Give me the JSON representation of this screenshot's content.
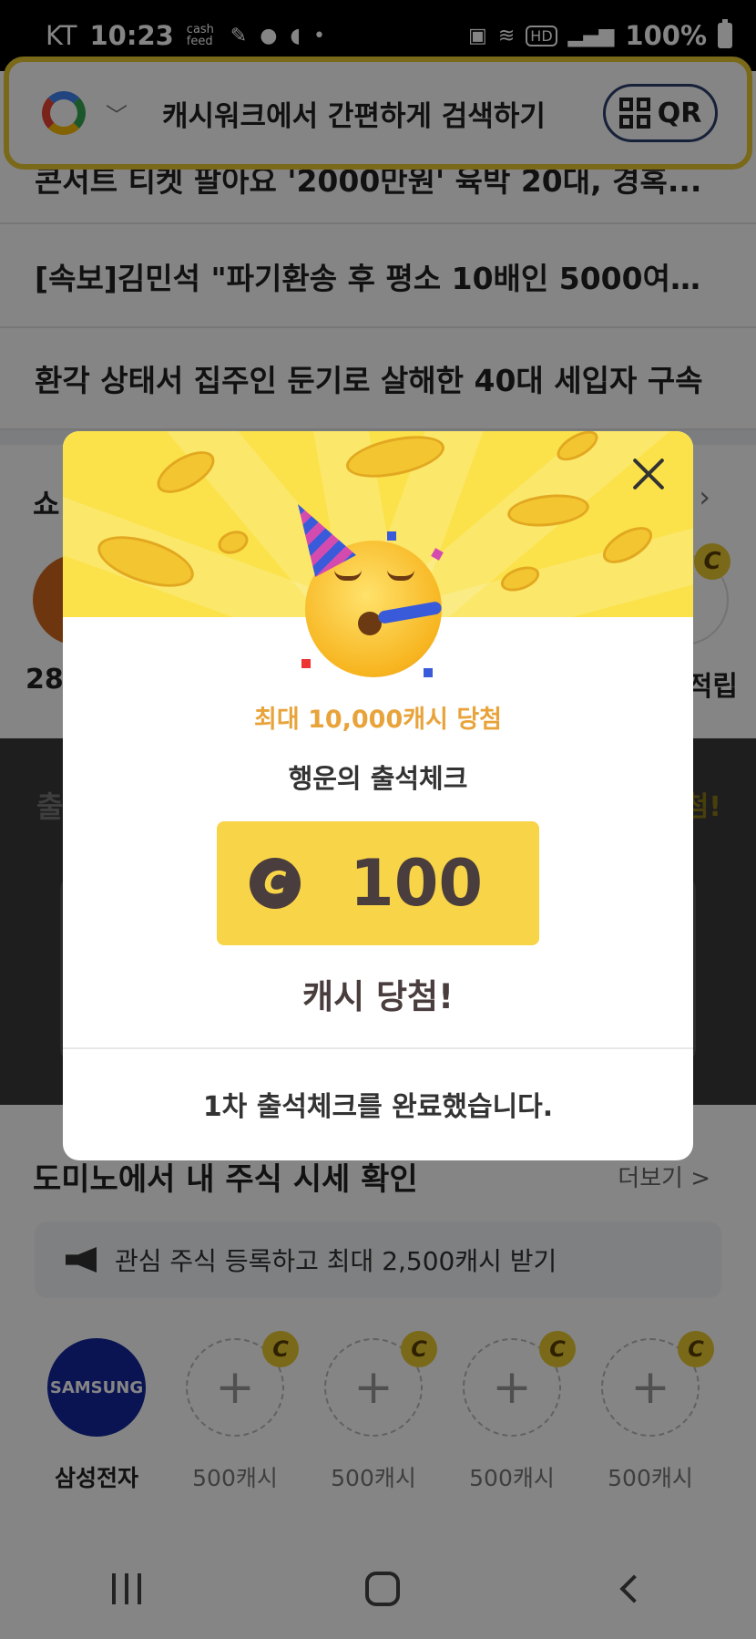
{
  "status_bar": {
    "carrier": "KT",
    "time": "10:23",
    "cashfeed_icon": "cash feed",
    "hd_label": "HD",
    "battery": "100%"
  },
  "search_bar": {
    "placeholder": "캐시워크에서 간편하게 검색하기",
    "qr_label": "QR"
  },
  "news": [
    {
      "text": "콘서트 티켓 팔아요 '2000만원' 육박 20대, 경혹..."
    },
    {
      "text": "[속보]김민석 \"파기환송 후 평소 10배인 5000여명..."
    },
    {
      "text": "환각 상태서 집주인 둔기로 살해한 40대 세입자 구속"
    }
  ],
  "shopping": {
    "title": "쇼",
    "left_label": "28°",
    "right_label": "적립",
    "coin": "C"
  },
  "dark_section": {
    "left_text": "출",
    "right_text": "첨!"
  },
  "stocks": {
    "title": "도미노에서 내 주식 시세 확인",
    "more": "더보기 >",
    "banner": "관심 주식 등록하고 최대 2,500캐시 받기",
    "items": [
      {
        "label": "삼성전자",
        "logo": "SAMSUNG"
      },
      {
        "label": "500캐시",
        "coin": "C"
      },
      {
        "label": "500캐시",
        "coin": "C"
      },
      {
        "label": "500캐시",
        "coin": "C"
      },
      {
        "label": "500캐시",
        "coin": "C"
      }
    ]
  },
  "modal": {
    "subtitle": "최대 10,000캐시 당첨",
    "title": "행운의 출석체크",
    "coin_symbol": "C",
    "amount": "100",
    "won_text": "캐시 당첨!",
    "completion": "1차 출석체크를 완료했습니다.",
    "colors": {
      "header_yellow": "#fbe24a",
      "prize_yellow": "#f7d448",
      "subtitle_orange": "#e8a33a"
    }
  }
}
